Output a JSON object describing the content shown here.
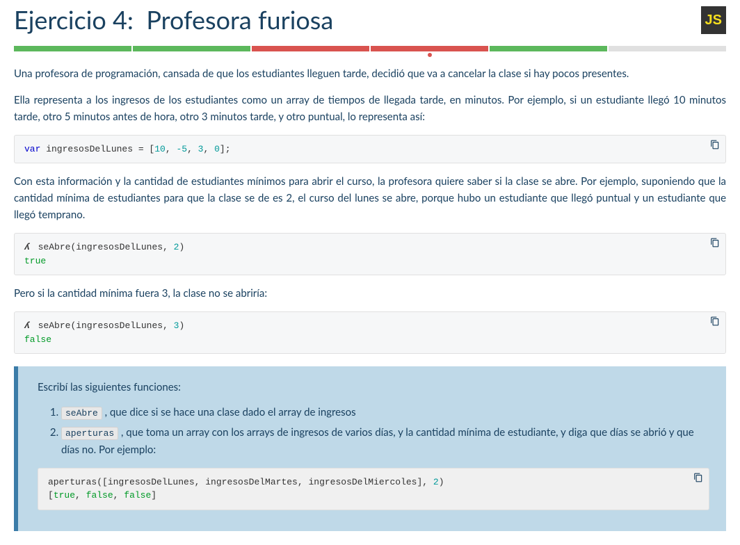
{
  "title_prefix": "Ejercicio 4:",
  "title_name": "Profesora furiosa",
  "js_badge": "JS",
  "progress": [
    "green",
    "green",
    "red",
    "red-current",
    "green",
    "gray"
  ],
  "para1": "Una profesora de programación, cansada de que los estudiantes lleguen tarde, decidió que va a cancelar la clase si hay pocos presentes.",
  "para2": "Ella representa a los ingresos de los estudiantes como un array de tiempos de llegada tarde, en minutos. Por ejemplo, si un estudiante llegó 10 minutos tarde, otro 5 minutos antes de hora, otro 3 minutos tarde, y otro puntual, lo representa así:",
  "code1": {
    "kw": "var",
    "varname": " ingresosDelLunes = [",
    "nums": [
      "10",
      "-5",
      "3",
      "0"
    ],
    "end": "];"
  },
  "para3": "Con esta información y la cantidad de estudiantes mínimos para abrir el curso, la profesora quiere saber si la clase se abre. Por ejemplo, suponiendo que la cantidad mínima de estudiantes para que la clase se de es 2, el curso del lunes se abre, porque hubo un estudiante que llegó puntual y un estudiante que llegó temprano.",
  "code2": {
    "call_fn": "seAbre",
    "call_args": "(ingresosDelLunes, ",
    "call_num": "2",
    "call_end": ")",
    "result": "true"
  },
  "para4": "Pero si la cantidad mínima fuera 3, la clase no se abriría:",
  "code3": {
    "call_fn": "seAbre",
    "call_args": "(ingresosDelLunes, ",
    "call_num": "3",
    "call_end": ")",
    "result": "false"
  },
  "task": {
    "intro": "Escribí las siguientes funciones:",
    "items": [
      {
        "code": "seAbre",
        "text": " , que dice si se hace una clase dado el array de ingresos"
      },
      {
        "code": "aperturas",
        "text": " , que toma un array con los arrays de ingresos de varios días, y la cantidad mínima de estudiante, y diga que días se abrió y que días no. Por ejemplo:"
      }
    ],
    "code": {
      "line1_a": "aperturas([ingresosDelLunes, ingresosDelMartes, ingresosDelMiercoles], ",
      "line1_num": "2",
      "line1_b": ")",
      "line2_a": "[",
      "line2_v1": "true",
      "line2_s1": ", ",
      "line2_v2": "false",
      "line2_s2": ", ",
      "line2_v3": "false",
      "line2_b": "]"
    }
  }
}
